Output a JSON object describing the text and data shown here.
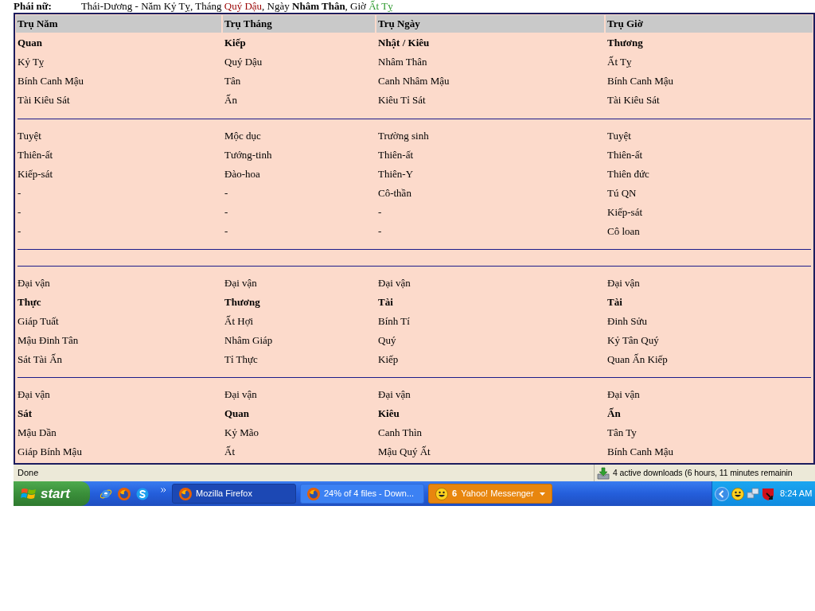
{
  "info_line": {
    "label": "Phái nữ:",
    "parts": [
      {
        "text": "Thái-Dương - Năm Kỷ Tỵ, Tháng ",
        "bold": false
      },
      {
        "text": "Quý Dậu",
        "bold": false,
        "color": "#990000"
      },
      {
        "text": ", Ngày ",
        "bold": false
      },
      {
        "text": "Nhâm Thân",
        "bold": true
      },
      {
        "text": ", Giờ ",
        "bold": false
      },
      {
        "text": "Ất Tỵ",
        "bold": false,
        "color": "#2e9a2e"
      }
    ]
  },
  "table": {
    "columns": [
      "Trụ Năm",
      "Trụ Tháng",
      "Trụ Ngày",
      "Trụ Giờ"
    ],
    "sections": [
      {
        "kind": "rows",
        "rows": [
          {
            "bold": true,
            "cells": [
              "Quan",
              "Kiếp",
              "Nhật / Kiêu",
              "Thương"
            ]
          },
          {
            "bold": false,
            "cells": [
              "Kỷ Tỵ",
              "Quý Dậu",
              "Nhâm Thân",
              "Ất Tỵ"
            ]
          },
          {
            "bold": false,
            "cells": [
              "Bính Canh Mậu",
              "Tân",
              "Canh Nhâm Mậu",
              "Bính Canh Mậu"
            ]
          },
          {
            "bold": false,
            "cells": [
              "Tài Kiêu Sát",
              "Ấn",
              "Kiêu Tỉ Sát",
              "Tài Kiêu Sát"
            ]
          }
        ]
      },
      {
        "kind": "rows",
        "rows": [
          {
            "bold": false,
            "cells": [
              "Tuyệt",
              "Mộc dục",
              "Trường sinh",
              "Tuyệt"
            ]
          },
          {
            "bold": false,
            "cells": [
              "Thiên-ất",
              "Tướng-tinh",
              "Thiên-ất",
              "Thiên-ất"
            ]
          },
          {
            "bold": false,
            "cells": [
              "Kiếp-sát",
              "Đào-hoa",
              "Thiên-Y",
              "Thiên đức"
            ]
          },
          {
            "bold": false,
            "cells": [
              "-",
              "-",
              "Cô-thần",
              "Tú QN"
            ]
          },
          {
            "bold": false,
            "cells": [
              "-",
              "-",
              "-",
              "Kiếp-sát"
            ]
          },
          {
            "bold": false,
            "cells": [
              "-",
              "-",
              "-",
              "Cô loan"
            ]
          }
        ]
      },
      {
        "kind": "blank"
      },
      {
        "kind": "rows",
        "rows": [
          {
            "bold": false,
            "cells": [
              "Đại vận",
              "Đại vận",
              "Đại vận",
              "Đại vận"
            ]
          },
          {
            "bold": true,
            "cells": [
              "Thực",
              "Thương",
              "Tài",
              "Tài"
            ]
          },
          {
            "bold": false,
            "cells": [
              "Giáp Tuất",
              "Ất Hợi",
              "Bính Tí",
              "Đinh Sửu"
            ]
          },
          {
            "bold": false,
            "cells": [
              "Mậu Đinh Tân",
              "Nhâm Giáp",
              "Quý",
              "Kỷ Tân Quý"
            ]
          },
          {
            "bold": false,
            "cells": [
              "Sát Tài Ấn",
              "Tỉ Thực",
              "Kiếp",
              "Quan Ấn Kiếp"
            ]
          }
        ]
      },
      {
        "kind": "rows",
        "rows": [
          {
            "bold": false,
            "cells": [
              "Đại vận",
              "Đại vận",
              "Đại vận",
              "Đại vận"
            ]
          },
          {
            "bold": true,
            "cells": [
              "Sát",
              "Quan",
              "Kiêu",
              "Ấn"
            ]
          },
          {
            "bold": false,
            "cells": [
              "Mậu Dần",
              "Kỷ Mão",
              "Canh Thìn",
              "Tân Ty"
            ]
          },
          {
            "bold": false,
            "cells": [
              "Giáp Bính Mậu",
              "Ất",
              "Mậu Quý Ất",
              "Bính Canh Mậu"
            ]
          }
        ]
      }
    ]
  },
  "status_bar": {
    "text": "Done",
    "downloads": "4 active downloads (6 hours, 11 minutes remainin"
  },
  "taskbar": {
    "start": "start",
    "tasks": [
      {
        "label": "Mozilla Firefox",
        "kind": "browser",
        "selected": true,
        "highlighted": false
      },
      {
        "label": "24% of 4 files - Down...",
        "kind": "browser",
        "selected": false,
        "highlighted": false
      },
      {
        "count": "6",
        "label": "Yahoo! Messenger",
        "kind": "messenger",
        "selected": false,
        "highlighted": true
      }
    ],
    "clock": "8:24 AM"
  }
}
